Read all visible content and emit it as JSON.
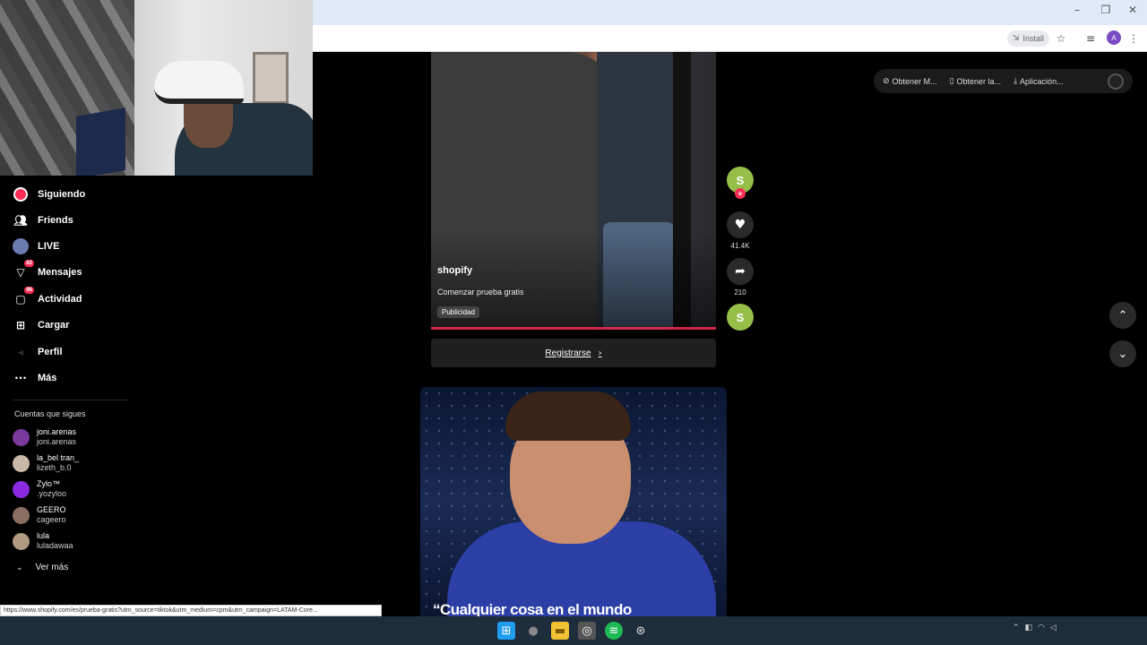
{
  "browser": {
    "install_label": "Install",
    "profile_initial": "A",
    "window_controls": {
      "minimize": "–",
      "maximize": "❐",
      "close": "✕"
    }
  },
  "sidebar": {
    "items": [
      {
        "label": "Siguiendo",
        "icon": "following-icon",
        "badge": ""
      },
      {
        "label": "Friends",
        "icon": "friends-icon",
        "badge": ""
      },
      {
        "label": "LIVE",
        "icon": "live-icon",
        "badge": ""
      },
      {
        "label": "Mensajes",
        "icon": "messages-icon",
        "badge": "82"
      },
      {
        "label": "Actividad",
        "icon": "activity-icon",
        "badge": "96"
      },
      {
        "label": "Cargar",
        "icon": "upload-icon",
        "badge": ""
      },
      {
        "label": "Perfil",
        "icon": "profile-icon",
        "badge": ""
      },
      {
        "label": "Más",
        "icon": "more-icon",
        "badge": ""
      }
    ],
    "following_title": "Cuentas que sigues",
    "accounts": [
      {
        "handle": "joni.arenas",
        "sub": "joni.arenas",
        "color": "#7a3a9c"
      },
      {
        "handle": "la_bel tran_",
        "sub": "lizeth_b.0",
        "color": "#c9b8a8"
      },
      {
        "handle": "Zylo™",
        "sub": ".yozyloo",
        "color": "#8a2be2"
      },
      {
        "handle": "GEERO",
        "sub": "cageero",
        "color": "#8a6e62"
      },
      {
        "handle": "lula",
        "sub": "luladawaa",
        "color": "#b09a80"
      }
    ],
    "see_more": "Ver más"
  },
  "feed": {
    "ad": {
      "author": "shopify",
      "description": "Comenzar prueba gratis",
      "tag": "Publicidad",
      "cta": "Registrarse",
      "likes": "41.4K",
      "shares": "210"
    },
    "next_video_caption": "“Cualquier cosa en el mundo"
  },
  "top_actions": {
    "item1": "Obtener M...",
    "item2": "Obtener la...",
    "item3": "Aplicación..."
  },
  "status_url": "https://www.shopify.com/es/prueba-gratis?utm_source=tiktok&utm_medium=cpm&utm_campaign=LATAM-Core...",
  "colors": {
    "accent": "#fe2c55",
    "shopify": "#95bf47",
    "chrome_bar": "#dfe9f8"
  }
}
